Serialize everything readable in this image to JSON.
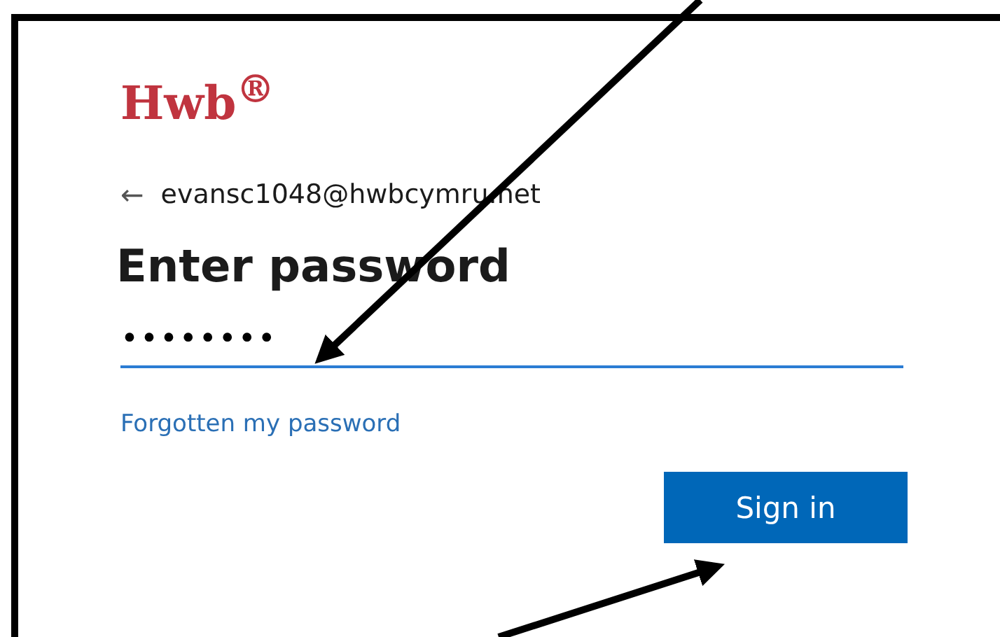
{
  "logo": "Hwb$^{®}$",
  "account": {
    "back_icon": "←",
    "email": "evansc1048@hwbcymru.net"
  },
  "title": "Enter password",
  "password_field": {
    "value": "••••••••"
  },
  "forgot_link": "Forgotten my password",
  "buttons": [
    {
      "label": "Sign in",
      "kind": "primary"
    }
  ]
}
